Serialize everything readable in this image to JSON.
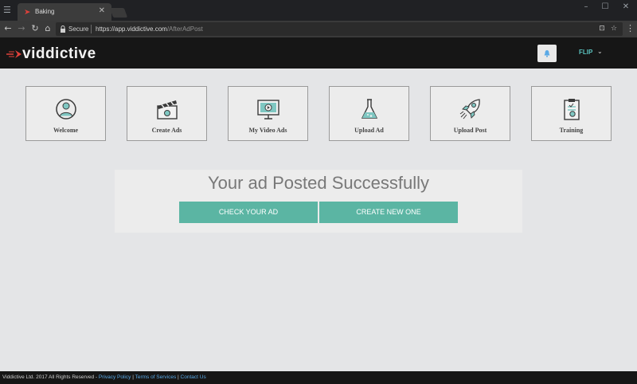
{
  "browser": {
    "tab_title": "Baking",
    "secure_label": "Secure",
    "url_host": "https://app.viddictive.com",
    "url_path": "/AfterAdPost"
  },
  "header": {
    "logo_text": "viddictive",
    "user_label": "FLIP"
  },
  "tiles": [
    {
      "label": "Welcome",
      "icon": "user-avatar-icon"
    },
    {
      "label": "Create Ads",
      "icon": "clapperboard-icon"
    },
    {
      "label": "My Video Ads",
      "icon": "monitor-play-icon"
    },
    {
      "label": "Upload Ad",
      "icon": "flask-icon"
    },
    {
      "label": "Upload Post",
      "icon": "rocket-icon"
    },
    {
      "label": "Training",
      "icon": "clipboard-icon"
    }
  ],
  "panel": {
    "title": "Your ad Posted Successfully",
    "check_button": "CHECK YOUR AD",
    "create_button": "CREATE NEW ONE"
  },
  "footer": {
    "copyright": "Viddictive Ltd. 2017 All Rights Reserved",
    "dash": " - ",
    "sep": " | ",
    "privacy": "Privacy Policy",
    "terms": "Terms of Services",
    "contact": "Contact Us"
  },
  "colors": {
    "accent_button": "#5bb5a3",
    "header_bg": "#161616",
    "page_bg": "#e4e5e7",
    "user_label": "#5bc4c0",
    "logo_mark": "#e0413a"
  }
}
